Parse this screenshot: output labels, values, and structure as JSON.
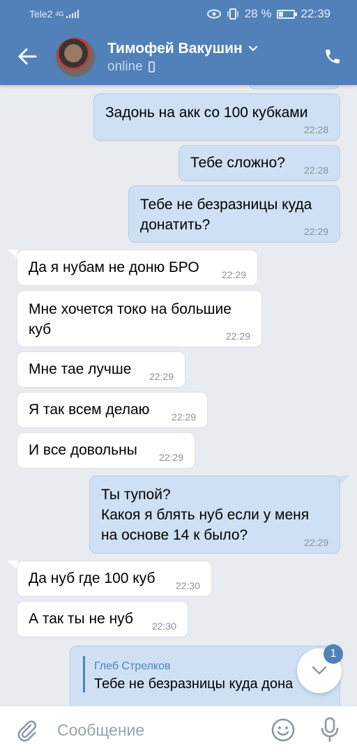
{
  "status_bar": {
    "carrier": "Tele2",
    "network": "4G",
    "battery": "28 %",
    "time": "22:39"
  },
  "header": {
    "contact_name": "Тимофей Вакушин",
    "presence": "online"
  },
  "messages": [
    {
      "dir": "out",
      "text": "Задонь на акк со 100 кубками",
      "time": "22:28"
    },
    {
      "dir": "out",
      "text": "Тебе сложно?",
      "time": "22:28"
    },
    {
      "dir": "out",
      "text": "Тебе не безразницы куда\nдонатить?",
      "time": "22:29"
    },
    {
      "dir": "in",
      "text": "Да я нубам не доню БРО",
      "time": "22:29"
    },
    {
      "dir": "in",
      "text": "Мне хочется токо на большие\nкуб",
      "time": "22:29"
    },
    {
      "dir": "in",
      "text": "Мне тае лучше",
      "time": "22:29"
    },
    {
      "dir": "in",
      "text": "Я так всем делаю",
      "time": "22:29"
    },
    {
      "dir": "in",
      "text": "И все довольны",
      "time": "22:29"
    },
    {
      "dir": "out",
      "text": "Ты тупой?\nКакоя я блять нуб если у меня\nна основе 14 к было?",
      "time": "22:29"
    },
    {
      "dir": "in",
      "text": "Да нуб где 100 куб",
      "time": "22:30"
    },
    {
      "dir": "in",
      "text": "А так ты не нуб",
      "time": "22:30"
    }
  ],
  "reply_message": {
    "author": "Глеб Стрелков",
    "quoted": "Тебе не безразницы куда дона"
  },
  "scroll_button": {
    "unread_count": "1"
  },
  "composer": {
    "placeholder": "Сообщение"
  },
  "colors": {
    "header": "#5181b8",
    "outgoing_bubble": "#cfe0f4",
    "incoming_bubble": "#ffffff",
    "background": "#e8ebef"
  }
}
